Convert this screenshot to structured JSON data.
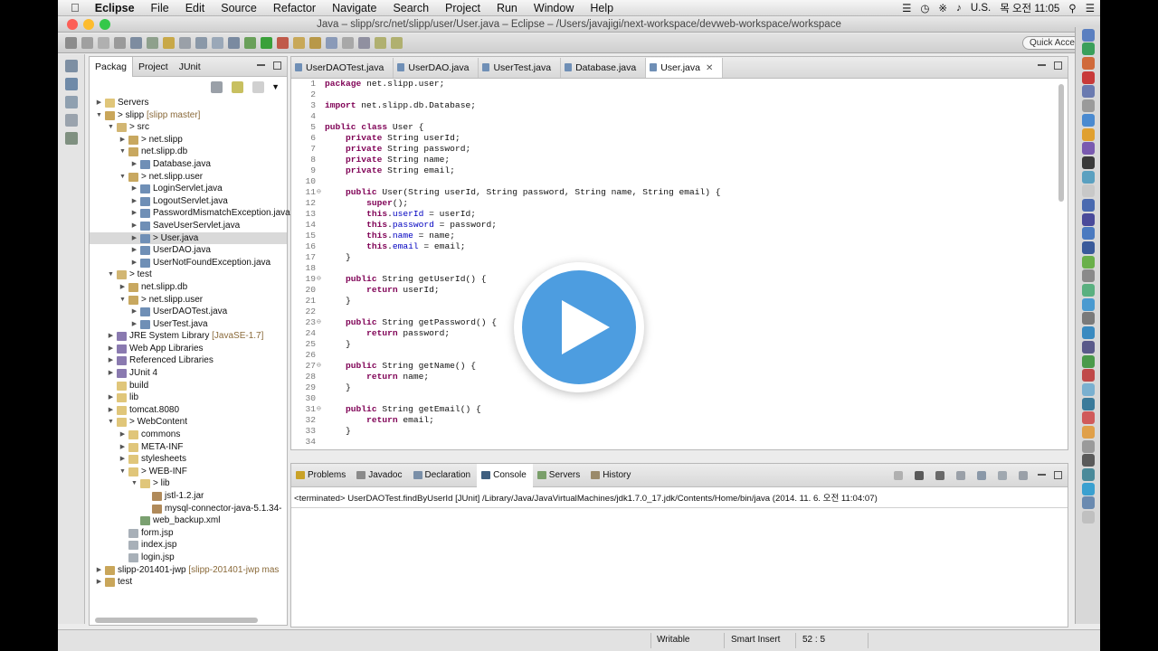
{
  "colors": {
    "play_button": "#4d9de0",
    "keyword": "#7f0055",
    "field": "#0000c0",
    "close_red": "#fc5f57",
    "min_yellow": "#fdbc2e",
    "max_green": "#34c84a"
  },
  "menubar": {
    "apple_icon": "apple-logo-icon",
    "app": "Eclipse",
    "items": [
      "File",
      "Edit",
      "Source",
      "Refactor",
      "Navigate",
      "Search",
      "Project",
      "Run",
      "Window",
      "Help"
    ],
    "input_source": "U.S.",
    "clock": "목 오전 11:05"
  },
  "window": {
    "title": "Java – slipp/src/net/slipp/user/User.java – Eclipse – /Users/javajigi/next-workspace/devweb-workspace/workspace"
  },
  "toolbar": {
    "quick_access": "Quick Access"
  },
  "package_explorer": {
    "tabs": [
      "Packag",
      "Project",
      "JUnit"
    ],
    "tree": [
      {
        "depth": 0,
        "tw": "▶",
        "icon": "folder",
        "label": "Servers",
        "dec": ""
      },
      {
        "depth": 0,
        "tw": "▼",
        "icon": "project",
        "label": "> slipp",
        "dec": " [slipp master]"
      },
      {
        "depth": 1,
        "tw": "▼",
        "icon": "srcfolder",
        "label": "> src",
        "dec": ""
      },
      {
        "depth": 2,
        "tw": "▶",
        "icon": "package",
        "label": "> net.slipp",
        "dec": ""
      },
      {
        "depth": 2,
        "tw": "▼",
        "icon": "package",
        "label": "net.slipp.db",
        "dec": ""
      },
      {
        "depth": 3,
        "tw": "▶",
        "icon": "java",
        "label": "Database.java",
        "dec": ""
      },
      {
        "depth": 2,
        "tw": "▼",
        "icon": "package",
        "label": "> net.slipp.user",
        "dec": ""
      },
      {
        "depth": 3,
        "tw": "▶",
        "icon": "java",
        "label": "LoginServlet.java",
        "dec": ""
      },
      {
        "depth": 3,
        "tw": "▶",
        "icon": "java",
        "label": "LogoutServlet.java",
        "dec": ""
      },
      {
        "depth": 3,
        "tw": "▶",
        "icon": "java",
        "label": "PasswordMismatchException.java",
        "dec": ""
      },
      {
        "depth": 3,
        "tw": "▶",
        "icon": "java",
        "label": "SaveUserServlet.java",
        "dec": ""
      },
      {
        "depth": 3,
        "tw": "▶",
        "icon": "java",
        "label": "> User.java",
        "dec": "",
        "selected": true
      },
      {
        "depth": 3,
        "tw": "▶",
        "icon": "java",
        "label": "UserDAO.java",
        "dec": ""
      },
      {
        "depth": 3,
        "tw": "▶",
        "icon": "java",
        "label": "UserNotFoundException.java",
        "dec": ""
      },
      {
        "depth": 1,
        "tw": "▼",
        "icon": "srcfolder",
        "label": "> test",
        "dec": ""
      },
      {
        "depth": 2,
        "tw": "▶",
        "icon": "package",
        "label": "net.slipp.db",
        "dec": ""
      },
      {
        "depth": 2,
        "tw": "▼",
        "icon": "package",
        "label": "> net.slipp.user",
        "dec": ""
      },
      {
        "depth": 3,
        "tw": "▶",
        "icon": "java",
        "label": "UserDAOTest.java",
        "dec": ""
      },
      {
        "depth": 3,
        "tw": "▶",
        "icon": "java",
        "label": "UserTest.java",
        "dec": ""
      },
      {
        "depth": 1,
        "tw": "▶",
        "icon": "library",
        "label": "JRE System Library",
        "dec": " [JavaSE-1.7]"
      },
      {
        "depth": 1,
        "tw": "▶",
        "icon": "library",
        "label": "Web App Libraries",
        "dec": ""
      },
      {
        "depth": 1,
        "tw": "▶",
        "icon": "library",
        "label": "Referenced Libraries",
        "dec": ""
      },
      {
        "depth": 1,
        "tw": "▶",
        "icon": "library",
        "label": "JUnit 4",
        "dec": ""
      },
      {
        "depth": 1,
        "tw": "",
        "icon": "folder",
        "label": "build",
        "dec": ""
      },
      {
        "depth": 1,
        "tw": "▶",
        "icon": "folder",
        "label": "lib",
        "dec": ""
      },
      {
        "depth": 1,
        "tw": "▶",
        "icon": "folder",
        "label": "tomcat.8080",
        "dec": ""
      },
      {
        "depth": 1,
        "tw": "▼",
        "icon": "folder",
        "label": "> WebContent",
        "dec": ""
      },
      {
        "depth": 2,
        "tw": "▶",
        "icon": "folder",
        "label": "commons",
        "dec": ""
      },
      {
        "depth": 2,
        "tw": "▶",
        "icon": "folder",
        "label": "META-INF",
        "dec": ""
      },
      {
        "depth": 2,
        "tw": "▶",
        "icon": "folder",
        "label": "stylesheets",
        "dec": ""
      },
      {
        "depth": 2,
        "tw": "▼",
        "icon": "folder",
        "label": "> WEB-INF",
        "dec": ""
      },
      {
        "depth": 3,
        "tw": "▼",
        "icon": "folder",
        "label": "> lib",
        "dec": ""
      },
      {
        "depth": 4,
        "tw": "",
        "icon": "jar",
        "label": "jstl-1.2.jar",
        "dec": ""
      },
      {
        "depth": 4,
        "tw": "",
        "icon": "jar",
        "label": "mysql-connector-java-5.1.34-",
        "dec": ""
      },
      {
        "depth": 3,
        "tw": "",
        "icon": "xml",
        "label": "web_backup.xml",
        "dec": ""
      },
      {
        "depth": 2,
        "tw": "",
        "icon": "file",
        "label": "form.jsp",
        "dec": ""
      },
      {
        "depth": 2,
        "tw": "",
        "icon": "file",
        "label": "index.jsp",
        "dec": ""
      },
      {
        "depth": 2,
        "tw": "",
        "icon": "file",
        "label": "login.jsp",
        "dec": ""
      },
      {
        "depth": 0,
        "tw": "▶",
        "icon": "project",
        "label": "slipp-201401-jwp",
        "dec": " [slipp-201401-jwp mas"
      },
      {
        "depth": 0,
        "tw": "▶",
        "icon": "project",
        "label": "test",
        "dec": ""
      }
    ]
  },
  "editor": {
    "tabs": [
      "UserDAOTest.java",
      "UserDAO.java",
      "UserTest.java",
      "Database.java",
      "User.java"
    ],
    "active_tab": "User.java",
    "lines": [
      {
        "n": "1",
        "t": "package net.slipp.user;"
      },
      {
        "n": "2",
        "t": ""
      },
      {
        "n": "3",
        "t": "import net.slipp.db.Database;"
      },
      {
        "n": "4",
        "t": ""
      },
      {
        "n": "5",
        "t": "public class User {"
      },
      {
        "n": "6",
        "t": "    private String userId;"
      },
      {
        "n": "7",
        "t": "    private String password;"
      },
      {
        "n": "8",
        "t": "    private String name;"
      },
      {
        "n": "9",
        "t": "    private String email;"
      },
      {
        "n": "10",
        "t": ""
      },
      {
        "n": "11",
        "t": "    public User(String userId, String password, String name, String email) {",
        "fold": true
      },
      {
        "n": "12",
        "t": "        super();"
      },
      {
        "n": "13",
        "t": "        this.userId = userId;"
      },
      {
        "n": "14",
        "t": "        this.password = password;"
      },
      {
        "n": "15",
        "t": "        this.name = name;"
      },
      {
        "n": "16",
        "t": "        this.email = email;"
      },
      {
        "n": "17",
        "t": "    }"
      },
      {
        "n": "18",
        "t": ""
      },
      {
        "n": "19",
        "t": "    public String getUserId() {",
        "fold": true
      },
      {
        "n": "20",
        "t": "        return userId;"
      },
      {
        "n": "21",
        "t": "    }"
      },
      {
        "n": "22",
        "t": ""
      },
      {
        "n": "23",
        "t": "    public String getPassword() {",
        "fold": true
      },
      {
        "n": "24",
        "t": "        return password;"
      },
      {
        "n": "25",
        "t": "    }"
      },
      {
        "n": "26",
        "t": ""
      },
      {
        "n": "27",
        "t": "    public String getName() {",
        "fold": true
      },
      {
        "n": "28",
        "t": "        return name;"
      },
      {
        "n": "29",
        "t": "    }"
      },
      {
        "n": "30",
        "t": ""
      },
      {
        "n": "31",
        "t": "    public String getEmail() {",
        "fold": true
      },
      {
        "n": "32",
        "t": "        return email;"
      },
      {
        "n": "33",
        "t": "    }"
      },
      {
        "n": "34",
        "t": ""
      }
    ]
  },
  "bottom_panel": {
    "tabs": [
      {
        "label": "Problems",
        "icon": "problems-icon",
        "color": "#c9a227"
      },
      {
        "label": "Javadoc",
        "icon": "javadoc-icon",
        "color": "#8a8a8a"
      },
      {
        "label": "Declaration",
        "icon": "declaration-icon",
        "color": "#7a8fa8"
      },
      {
        "label": "Console",
        "icon": "console-icon",
        "color": "#3f5f7f",
        "active": true
      },
      {
        "label": "Servers",
        "icon": "servers-icon",
        "color": "#7a9f6a"
      },
      {
        "label": "History",
        "icon": "history-icon",
        "color": "#9a8a6a"
      }
    ],
    "console_text": "<terminated> UserDAOTest.findByUserId [JUnit] /Library/Java/JavaVirtualMachines/jdk1.7.0_17.jdk/Contents/Home/bin/java (2014. 11. 6. 오전 11:04:07)"
  },
  "statusbar": {
    "writable": "Writable",
    "insert_mode": "Smart Insert",
    "position": "52 : 5"
  },
  "overlay": {
    "icon": "play-button-icon"
  }
}
